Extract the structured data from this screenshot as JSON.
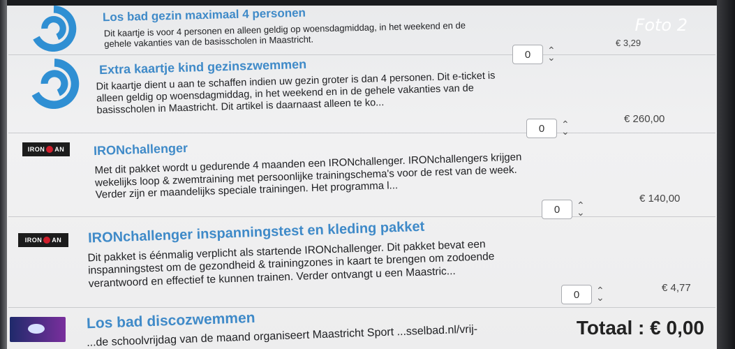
{
  "watermark": "Foto 2",
  "items": [
    {
      "title": "Los bad gezin maximaal 4 personen",
      "description": "Dit kaartje is voor 4 personen en alleen geldig op woensdagmiddag, in het weekend en de gehele vakanties van de basisscholen in Maastricht.",
      "quantity": "0",
      "price": "€ 3,29"
    },
    {
      "title": "Extra kaartje kind gezinszwemmen",
      "description": "Dit kaartje dient u aan te schaffen indien uw gezin groter is dan 4 personen. Dit e-ticket is alleen geldig op woensdagmiddag, in het weekend en in de gehele vakanties van de basisscholen in Maastricht. Dit artikel is daarnaast alleen te ko...",
      "quantity": "0",
      "price": "€ 260,00"
    },
    {
      "title": "IRONchallenger",
      "description": "Met dit pakket wordt u gedurende 4 maanden een IRONchallenger. IRONchallengers krijgen wekelijks loop & zwemtraining met persoonlijke trainingschema's voor de rest van de week. Verder zijn er maandelijks speciale trainingen. Het programma l...",
      "quantity": "0",
      "price": "€ 140,00"
    },
    {
      "title": "IRONchallenger inspanningstest en kleding pakket",
      "description": "Dit pakket is éénmalig verplicht als startende IRONchallenger. Dit pakket bevat een inspanningstest om de gezondheid & trainingzones in kaart te brengen om zodoende verantwoord en effectief te kunnen trainen. Verder ontvangt u een Maastric...",
      "quantity": "0",
      "price": "€ 4,77"
    },
    {
      "title": "Los bad discozwemmen",
      "description": "...de schoolvrijdag van de maand organiseert Maastricht Sport ...sselbad.nl/vrij-"
    }
  ],
  "total": "Totaal : € 0,00",
  "icons": {
    "swim_logo": "swim-logo-icon",
    "iron_logo": "ironman-logo-icon",
    "stepper": "stepper-icon"
  },
  "colors": {
    "title": "#3f8ac8",
    "logo": "#2f8fd3"
  }
}
